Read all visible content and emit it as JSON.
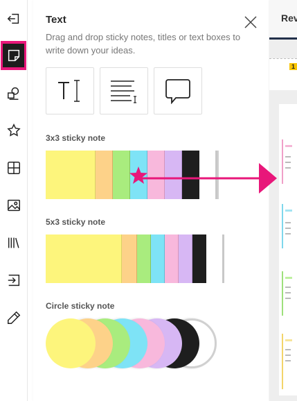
{
  "panel": {
    "title": "Text",
    "description": "Drag and drop sticky notes, titles or text boxes to write down your ideas.",
    "close_icon": "close-icon"
  },
  "rail": {
    "items": [
      {
        "icon": "exit-panel-icon"
      },
      {
        "icon": "sticky-note-icon",
        "active": true
      },
      {
        "icon": "shapes-icon"
      },
      {
        "icon": "star-icon"
      },
      {
        "icon": "grid-icon"
      },
      {
        "icon": "image-icon"
      },
      {
        "icon": "library-icon"
      },
      {
        "icon": "import-icon"
      },
      {
        "icon": "pencil-icon"
      }
    ]
  },
  "tools": [
    {
      "icon": "text-title-icon"
    },
    {
      "icon": "text-paragraph-icon"
    },
    {
      "icon": "text-callout-icon"
    }
  ],
  "sections": {
    "sticky_3x3": "3x3 sticky note",
    "sticky_5x3": "5x3 sticky note",
    "circle": "Circle sticky note"
  },
  "colors": {
    "accent": "#e8177a",
    "yellow": "#fdf57c",
    "orange": "#fdd289",
    "green": "#a9ec7e",
    "cyan": "#7ee3f6",
    "pink": "#f8b8dc",
    "purple": "#d7b7f4",
    "black": "#1e1e1e",
    "white": "#ffffff"
  },
  "document": {
    "header_text": "Rev",
    "badge": "1"
  }
}
